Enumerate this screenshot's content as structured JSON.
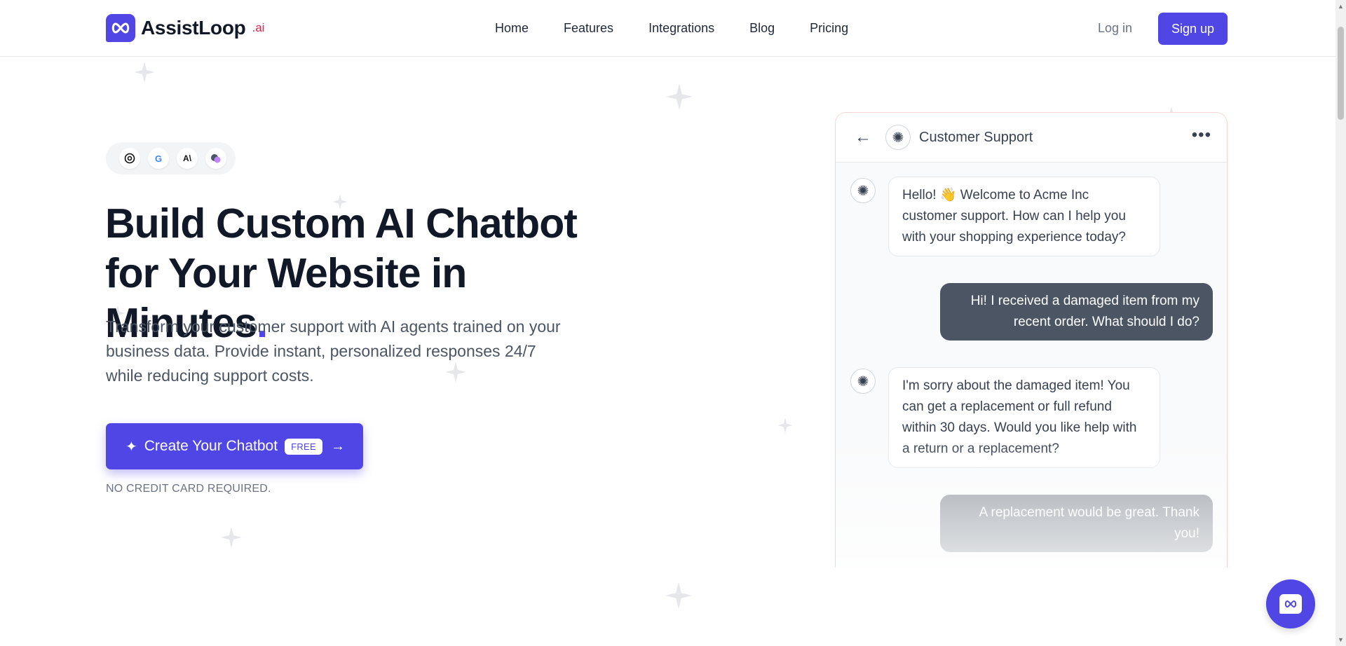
{
  "header": {
    "logo_text": "AssistLoop",
    "logo_suffix": ".ai",
    "nav": [
      "Home",
      "Features",
      "Integrations",
      "Blog",
      "Pricing"
    ],
    "login_label": "Log in",
    "signup_label": "Sign up"
  },
  "hero": {
    "providers": [
      "openai-icon",
      "google-icon",
      "anthropic-icon",
      "gemini-icon"
    ],
    "title_line1": "Build Custom AI Chatbot",
    "title_line2": "for Your Website in Minutes",
    "title_dot": ".",
    "subtitle": "Transform your customer support with AI agents trained on your business data. Provide instant, personalized responses 24/7 while reducing support costs.",
    "cta_label": "Create Your Chatbot",
    "cta_badge": "FREE",
    "no_card": "NO CREDIT CARD REQUIRED."
  },
  "chat": {
    "title": "Customer Support",
    "messages": [
      {
        "from": "bot",
        "text": "Hello! 👋 Welcome to Acme Inc customer support. How can I help you with your shopping experience today?"
      },
      {
        "from": "user",
        "text": "Hi! I received a damaged item from my recent order. What should I do?"
      },
      {
        "from": "bot",
        "text": "I'm sorry about the damaged item! You can get a replacement or full refund within 30 days. Would you like help with a return or a replacement?"
      },
      {
        "from": "user",
        "text": "A replacement would be great. Thank you!"
      }
    ]
  },
  "colors": {
    "accent": "#4f46e5",
    "user_bubble": "#4b5563",
    "logo_suffix": "#e11d48"
  }
}
